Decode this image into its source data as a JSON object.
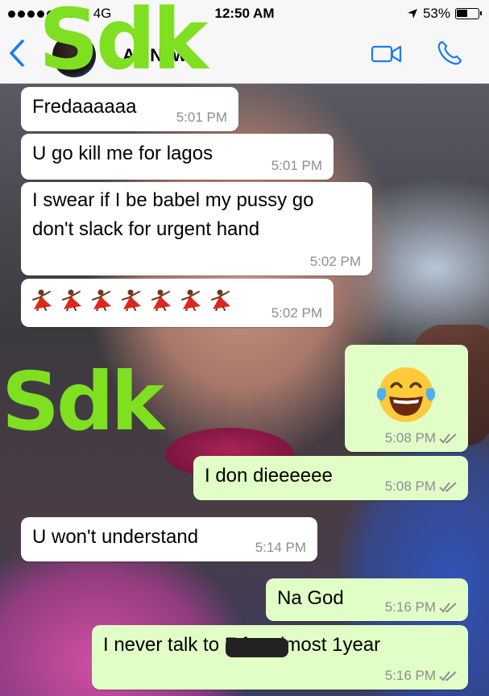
{
  "status_bar": {
    "carrier": "EE",
    "network": "4G",
    "time": "12:50 AM",
    "battery_percent": "53%",
    "battery_level": 0.53
  },
  "header": {
    "back_icon": "chevron-left-icon",
    "title": "AY New",
    "video_icon": "video-camera-icon",
    "call_icon": "phone-icon"
  },
  "watermark": {
    "top": "Sdk",
    "side": "Sdk",
    "color": "#7ee021"
  },
  "messages": [
    {
      "direction": "incoming",
      "text": "Fredaaaaaa",
      "time": "5:01 PM"
    },
    {
      "direction": "incoming",
      "text": "U go kill me for lagos",
      "time": "5:01 PM"
    },
    {
      "direction": "incoming",
      "text_line1": "I swear if I be babel my pussy go",
      "text_line2": "don't slack for urgent hand",
      "time": "5:02 PM"
    },
    {
      "direction": "incoming",
      "emoji": "dancer-emoji",
      "emoji_count": 7,
      "time": "5:02 PM"
    },
    {
      "direction": "outgoing",
      "emoji": "tears-of-joy-emoji",
      "time": "5:08 PM",
      "read": true
    },
    {
      "direction": "outgoing",
      "text": "I don dieeeeee",
      "time": "5:08 PM",
      "read": true
    },
    {
      "direction": "incoming",
      "text": "U won't understand",
      "time": "5:14 PM"
    },
    {
      "direction": "outgoing",
      "text": "Na God",
      "time": "5:16 PM",
      "read": true
    },
    {
      "direction": "outgoing",
      "text": "I never talk to F     for almost 1year",
      "time": "5:16 PM",
      "read": true
    }
  ],
  "colors": {
    "incoming_bubble": "#ffffff",
    "outgoing_bubble": "#e1fec6",
    "accent": "#1a7cf5",
    "read_ticks": "#8e8e93"
  }
}
